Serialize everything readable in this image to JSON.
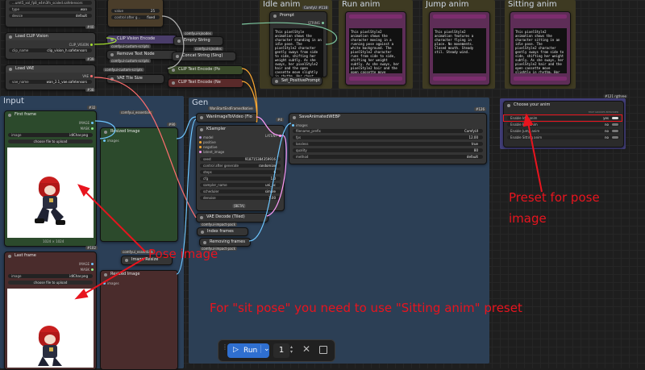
{
  "groups": {
    "idle": "Idle anim",
    "run": "Run anim",
    "jump": "Jump anim",
    "sitting": "Sitting anim",
    "input": "Input",
    "gen": "Gen"
  },
  "top_left": {
    "first_node_title": "...umt5_xxl_fp8_e4m3fn_scaled.safetensors",
    "type_label": "type",
    "type_value": "wan",
    "device_label": "device",
    "device_value": "default",
    "badge_a": "#40",
    "clip_vision_title": "Load CLIP Vision",
    "clip_vision_out": "CLIP_VISION",
    "clip_name_label": "clip_name",
    "clip_vision_value": "clip_vision_h.safetensors",
    "badge_b": "#39",
    "vae_title": "Load VAE",
    "vae_out": "VAE",
    "vae_name_label": "vae_name",
    "vae_value": "wan_2.1_vae.safetensors",
    "badge_c": "#38"
  },
  "mid_top": {
    "value_label": "value",
    "value_value": "25",
    "control_label": "control after g...",
    "control_value": "fixed",
    "clip_vision_encode": "CLIP Vision Encode",
    "comfyui_custom_scripts_1": "comfyui-custom-scripts",
    "remove_text_node": "Remove Text Node",
    "comfyui_custom_scripts_2": "comfyui-custom-scripts",
    "vae_tile_size": "VAE Tile Size",
    "concat_string": "Concat String (Sing)",
    "empty_string": "Empty String",
    "comfyui_kjnodes": "comfyui-kjnodes",
    "comfyui_kjnodes_2": "comfyui-kjnodes",
    "clip_text_encode_pos": "CLIP Text Encode (Po",
    "clip_text_encode_neg": "CLIP Text Encode (Ne",
    "comfyui_custom_scripts_3": "comfyui-custom-scripts"
  },
  "prompt_nodes": {
    "prompt_title": "Prompt",
    "comfyui_badge": "ComfyU",
    "prompt_badge": "#118",
    "string_label": "STRING",
    "idle_text": "This pixelStyle animation shows the character standing in an idle pose. The pixelStyle2 character gently sways from side to side, shifting her weight subtly. As she sways, her pixelStyle2 hair and the open cassette move slightly in rhythm. Her chest rises and falls subtly.",
    "run_text": "This pixelStyle2 animation shows the character moving in a running pose against a white background. The pixelStyle2 character runs from side to side, shifting her weight subtly. As she sways, her pixelStyle2 hair and the open cassette move slightly in rhythm. Her chest rises and falls subtly.",
    "jump_text": "This pixelStyle2 animation features a character flying in place. No movements. Closed mouth. Steady stil. Steady wind.",
    "sitting_text": "This pixelStyle2 animation shows the character sitting in an idle pose. The pixelStyle2 character gently sways from side to side, shifting her weight subtly. As she sways, her pixelStyle2 hair and the open cassette move slightly in rhythm. Her chest rises and falls subtly.",
    "set_positive": "Set_PositivePrompt"
  },
  "input_group": {
    "badge_first": "#32",
    "first_frame_title": "First frame",
    "image_out": "IMAGE",
    "mask_out": "MASK",
    "image_label": "image",
    "first_file": "idlChar.png",
    "upload_label": "choose file to upload",
    "resized_label": "Resized Image",
    "images_label": "images",
    "comfyui_essentials": "comfyui_essentials",
    "badge_90": "#90",
    "dims": "1024 × 1024",
    "badge_last": "#102",
    "last_frame_title": "Last frame",
    "last_file": "idlChar.png",
    "comfyui_essentials_2": "comfyui_essentials",
    "image_resize": "Image Resize",
    "resized_label_2": "Resized Image",
    "images_label_2": "images"
  },
  "gen_group": {
    "wan_tag": "WanStartEndFramesNative",
    "wan_node": "WanImageToVideo (Flo",
    "badge_4": "#4",
    "ksampler": "KSampler",
    "ks_inputs": [
      "model",
      "positive",
      "negative",
      "latent_image"
    ],
    "latent_out": "LATENT",
    "ks_widgets": [
      {
        "label": "seed",
        "value": "918715384359916"
      },
      {
        "label": "control after generate",
        "value": "randomize"
      },
      {
        "label": "steps",
        "value": "6"
      },
      {
        "label": "cfg",
        "value": "1.0"
      },
      {
        "label": "sampler_name",
        "value": "uni_pc"
      },
      {
        "label": "scheduler",
        "value": "simple"
      },
      {
        "label": "denoise",
        "value": "1.00"
      }
    ],
    "beta_badge": "[BETA]",
    "vae_decode": "VAE Decode (Tiled)",
    "comfyui_impact_pack": "comfyui-impact-pack",
    "index_frames": "Index frames",
    "removing_frames": "Removing frames",
    "comfyui_impact_pack_2": "comfyui-impact-pack",
    "save_node": "SaveAnimatedWEBP",
    "save_badge": "#126",
    "save_images": "images",
    "save_widgets": [
      {
        "label": "filename_prefix",
        "value": "ComfyUI"
      },
      {
        "label": "fps",
        "value": "12.00"
      },
      {
        "label": "lossless",
        "value": "true"
      },
      {
        "label": "quality",
        "value": "80"
      },
      {
        "label": "method",
        "value": "default"
      }
    ]
  },
  "anim_chooser": {
    "badge": "#121 rgthree",
    "title": "Choose your anim",
    "subtitle": "FAST GROUPS BYPASSER",
    "options": [
      {
        "label": "Enable Idle anim",
        "value": "yes"
      },
      {
        "label": "Enable Run anim",
        "value": "no"
      },
      {
        "label": "Enable Jump anim",
        "value": "no"
      },
      {
        "label": "Enable Sitting anim",
        "value": "no"
      }
    ]
  },
  "annotations": {
    "pose_image": "Pose image",
    "preset_line1": "Preset for pose",
    "preset_line2": "image",
    "sit_note": "For \"sit pose\" you need to use \"Sitting anim\" preset"
  },
  "toolbar": {
    "run_label": "Run",
    "count": "1"
  },
  "colors": {
    "annotation_red": "#e8141e",
    "run_button": "#2f6fd0",
    "idle_group": "#3e3a22",
    "input_group": "#2b3f57",
    "gen_group": "#2c3f55",
    "chooser_group": "#423f7a"
  }
}
